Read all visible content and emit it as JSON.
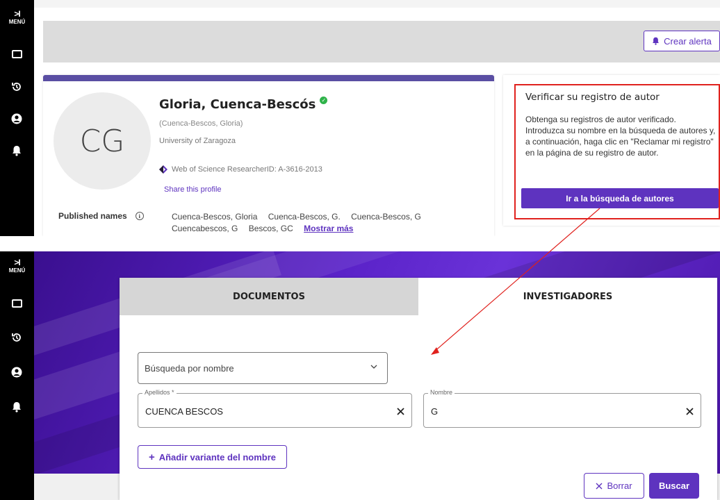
{
  "sidebar": {
    "toggle_chevron": ">I",
    "toggle_label": "MENÚ",
    "icons": [
      "folder-icon",
      "history-icon",
      "user-icon",
      "bell-icon"
    ]
  },
  "top": {
    "alert_button": "Crear alerta",
    "profile": {
      "initials": "CG",
      "name": "Gloria, Cuenca-Bescós",
      "alt_name": "(Cuenca-Bescos, Gloria)",
      "institution": "University of Zaragoza",
      "researcher_id": "Web of Science ResearcherID: A-3616-2013",
      "share": "Share this profile",
      "published_label": "Published names",
      "info_glyph": "i",
      "published_names": [
        "Cuenca-Bescos, Gloria",
        "Cuenca-Bescos, G.",
        "Cuenca-Bescos, G",
        "Cuencabescos, G",
        "Bescos, GC"
      ],
      "show_more": "Mostrar más"
    },
    "verify": {
      "title": "Verificar su registro de autor",
      "text": "Obtenga su registros de autor verificado. Introduzca su nombre en la búsqueda de autores y, a continuación, haga clic en \"Reclamar mi registro\" en la página de su registro de autor.",
      "button": "Ir a la búsqueda de autores"
    }
  },
  "bottom": {
    "tabs": [
      "DOCUMENTOS",
      "INVESTIGADORES"
    ],
    "search_type": "Búsqueda por nombre",
    "apellidos_label": "Apellidos *",
    "apellidos_value": "CUENCA BESCOS",
    "nombre_label": "Nombre",
    "nombre_value": "G",
    "add_variant": "Añadir variante del nombre",
    "clear": "Borrar",
    "search": "Buscar"
  },
  "colors": {
    "accent": "#5e33bf",
    "highlight": "#e0211d",
    "sidebar": "#000000",
    "hero": "#5a22c8"
  }
}
